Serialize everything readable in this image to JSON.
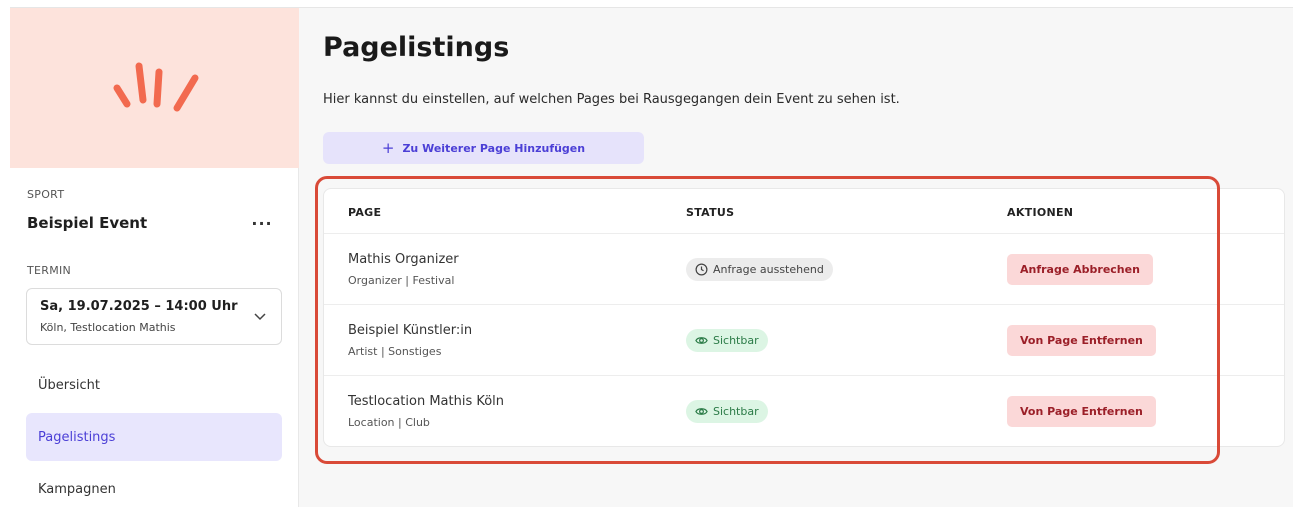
{
  "sidebar": {
    "category": "SPORT",
    "event_title": "Beispiel Event",
    "more_label": "···",
    "termin_label": "TERMIN",
    "date": {
      "main": "Sa, 19.07.2025 – 14:00 Uhr",
      "sub": "Köln, Testlocation Mathis"
    },
    "nav": [
      {
        "label": "Übersicht",
        "active": false
      },
      {
        "label": "Pagelistings",
        "active": true
      },
      {
        "label": "Kampagnen",
        "active": false
      }
    ],
    "logo_icon": "sparkle-burst-icon",
    "logo_color": "#f26a4f"
  },
  "main": {
    "title": "Pagelistings",
    "description": "Hier kannst du einstellen, auf welchen Pages bei Rausgegangen dein Event zu sehen ist.",
    "add_button": {
      "icon": "plus-icon",
      "label": "Zu Weiterer Page Hinzufügen"
    },
    "table": {
      "headers": {
        "page": "PAGE",
        "status": "STATUS",
        "actions": "AKTIONEN"
      },
      "rows": [
        {
          "name": "Mathis Organizer",
          "sub": "Organizer | Festival",
          "status": "Anfrage ausstehend",
          "status_type": "pending",
          "action": "Anfrage Abbrechen"
        },
        {
          "name": "Beispiel Künstler:in",
          "sub": "Artist | Sonstiges",
          "status": "Sichtbar",
          "status_type": "visible",
          "action": "Von Page Entfernen"
        },
        {
          "name": "Testlocation Mathis Köln",
          "sub": "Location | Club",
          "status": "Sichtbar",
          "status_type": "visible",
          "action": "Von Page Entfernen"
        }
      ]
    }
  },
  "colors": {
    "accent": "#4b3fd6",
    "accent_bg": "#e6e3fb",
    "danger_text": "#9b1f28",
    "danger_bg": "#fbd8d8",
    "success_text": "#2b7b47",
    "success_bg": "#dcf5e4",
    "highlight": "#d94a38"
  }
}
